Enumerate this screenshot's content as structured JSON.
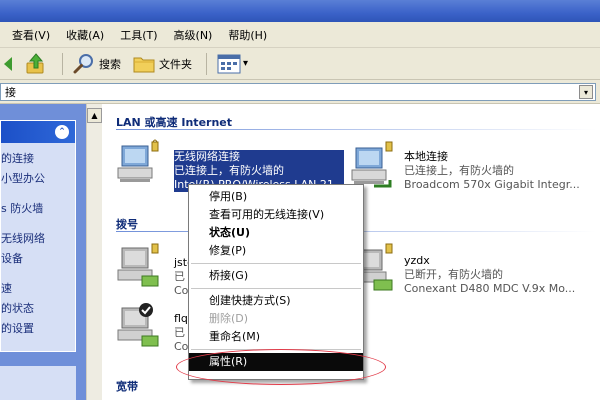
{
  "menubar": {
    "items": [
      "查看(V)",
      "收藏(A)",
      "工具(T)",
      "高级(N)",
      "帮助(H)"
    ]
  },
  "toolbar": {
    "search_label": "搜索",
    "folders_label": "文件夹",
    "view_dropdown_arrow": "▾"
  },
  "address": {
    "value": "接",
    "drop_arrow": "▾"
  },
  "left_panel": {
    "collapse_glyph": "⌃",
    "tasks": [
      "的连接",
      "小型办公",
      "s 防火墙",
      "无线网络",
      "设备",
      "速",
      "的状态",
      "的设置"
    ]
  },
  "scrollbar": {
    "up_arrow": "▲"
  },
  "groups": {
    "lan": "LAN 或高速 Internet",
    "dialup": "拨号",
    "broadband": "宽带"
  },
  "connections": {
    "wireless": {
      "name": "无线网络连接",
      "status": "已连接上，有防火墙的",
      "device": "Intel(R) PRO/Wireless LAN 21..."
    },
    "local": {
      "name": "本地连接",
      "status": "已连接上，有防火墙的",
      "device": "Broadcom 570x Gigabit Integr..."
    },
    "dial1": {
      "name": "jsto",
      "status": "已",
      "device": "Cor"
    },
    "dial2": {
      "name": "flqp",
      "status": "已",
      "device": "Cor"
    },
    "yzdx": {
      "name": "yzdx",
      "status": "已断开，有防火墙的",
      "device": "Conexant D480 MDC V.9x Mo..."
    }
  },
  "context_menu": {
    "disable": "停用(B)",
    "view_wireless": "查看可用的无线连接(V)",
    "status": "状态(U)",
    "repair": "修复(P)",
    "bridge": "桥接(G)",
    "shortcut": "创建快捷方式(S)",
    "delete": "删除(D)",
    "rename": "重命名(M)",
    "properties": "属性(R)"
  },
  "colors": {
    "title_bar": "#3b62c8",
    "menu_bg": "#ece9d8",
    "task_pane": "#6f8fd9",
    "selection": "#1f3b8f",
    "menu_highlight": "#0a0a0a",
    "annotation_circle": "#e23c4a"
  },
  "icons": [
    "back-forward-icon",
    "search-icon",
    "folder-icon",
    "views-icon",
    "network-computer-icon",
    "firewall-lock-icon",
    "modem-phone-icon"
  ]
}
